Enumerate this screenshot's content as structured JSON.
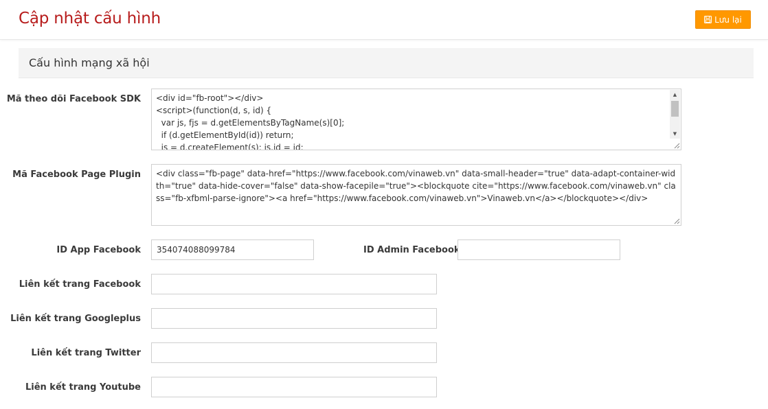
{
  "header": {
    "title": "Cập nhật cấu hình",
    "save_label": "Lưu lại"
  },
  "section": {
    "title": "Cấu hình mạng xã hội"
  },
  "form": {
    "sdk": {
      "label": "Mã theo dõi Facebook SDK",
      "value_lines": [
        "<div id=\"fb-root\"></div>",
        "<script>(function(d, s, id) {",
        "  var js, fjs = d.getElementsByTagName(s)[0];",
        "  if (d.getElementById(id)) return;",
        "  js = d.createElement(s); js.id = id;"
      ]
    },
    "page_plugin": {
      "label": "Mã Facebook Page Plugin",
      "value": "<div class=\"fb-page\" data-href=\"https://www.facebook.com/vinaweb.vn\" data-small-header=\"true\" data-adapt-container-width=\"true\" data-hide-cover=\"false\" data-show-facepile=\"true\"><blockquote cite=\"https://www.facebook.com/vinaweb.vn\" class=\"fb-xfbml-parse-ignore\"><a href=\"https://www.facebook.com/vinaweb.vn\">Vinaweb.vn</a></blockquote></div>"
    },
    "app_id": {
      "label": "ID App Facebook",
      "value": "354074088099784"
    },
    "admin_id": {
      "label": "ID Admin Facebook",
      "value": ""
    },
    "facebook_link": {
      "label": "Liên kết trang Facebook",
      "value": ""
    },
    "googleplus_link": {
      "label": "Liên kết trang Googleplus",
      "value": ""
    },
    "twitter_link": {
      "label": "Liên kết trang Twitter",
      "value": ""
    },
    "youtube_link": {
      "label": "Liên kết trang Youtube",
      "value": ""
    }
  },
  "icons": {
    "save": "floppy-disk-icon"
  },
  "colors": {
    "title": "#b71c1c",
    "save_button": "#ff9800",
    "section_bg": "#f4f4f4"
  }
}
